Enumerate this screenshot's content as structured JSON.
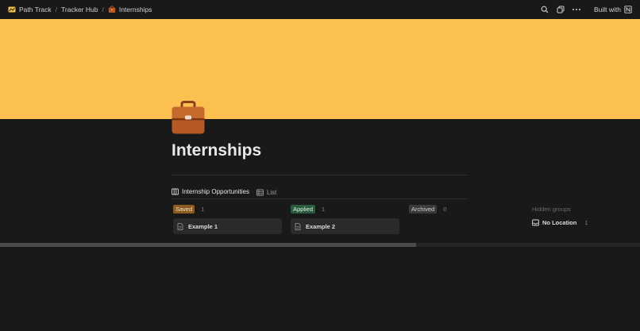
{
  "topbar": {
    "breadcrumbs": [
      {
        "label": "Path Track",
        "icon": "path-track-logo-icon"
      },
      {
        "label": "Tracker Hub"
      },
      {
        "label": "Internships",
        "icon": "briefcase-icon"
      }
    ],
    "separator": "/",
    "built_with": "Built with"
  },
  "cover": {
    "color": "#fbc050"
  },
  "page": {
    "title": "Internships",
    "icon": "briefcase-icon"
  },
  "views": {
    "tabs": [
      {
        "label": "Internship Opportunities",
        "icon": "board-icon",
        "active": true
      },
      {
        "label": "List",
        "icon": "list-icon",
        "active": false
      }
    ]
  },
  "board": {
    "groups": [
      {
        "label": "Saved",
        "count": "1",
        "badge_bg": "#8a5a23",
        "badge_fg": "#f4e0c6",
        "cards": [
          "Example 1"
        ]
      },
      {
        "label": "Applied",
        "count": "1",
        "badge_bg": "#2b5a3f",
        "badge_fg": "#d6efdf",
        "cards": [
          "Example 2"
        ]
      },
      {
        "label": "Archived",
        "count": "0",
        "badge_bg": "#3a3a3a",
        "badge_fg": "#d0d0d0",
        "cards": []
      }
    ],
    "hidden_groups_label": "Hidden groups",
    "hidden_groups": [
      {
        "label": "No Location",
        "count": "1",
        "icon": "inbox-icon"
      }
    ]
  }
}
